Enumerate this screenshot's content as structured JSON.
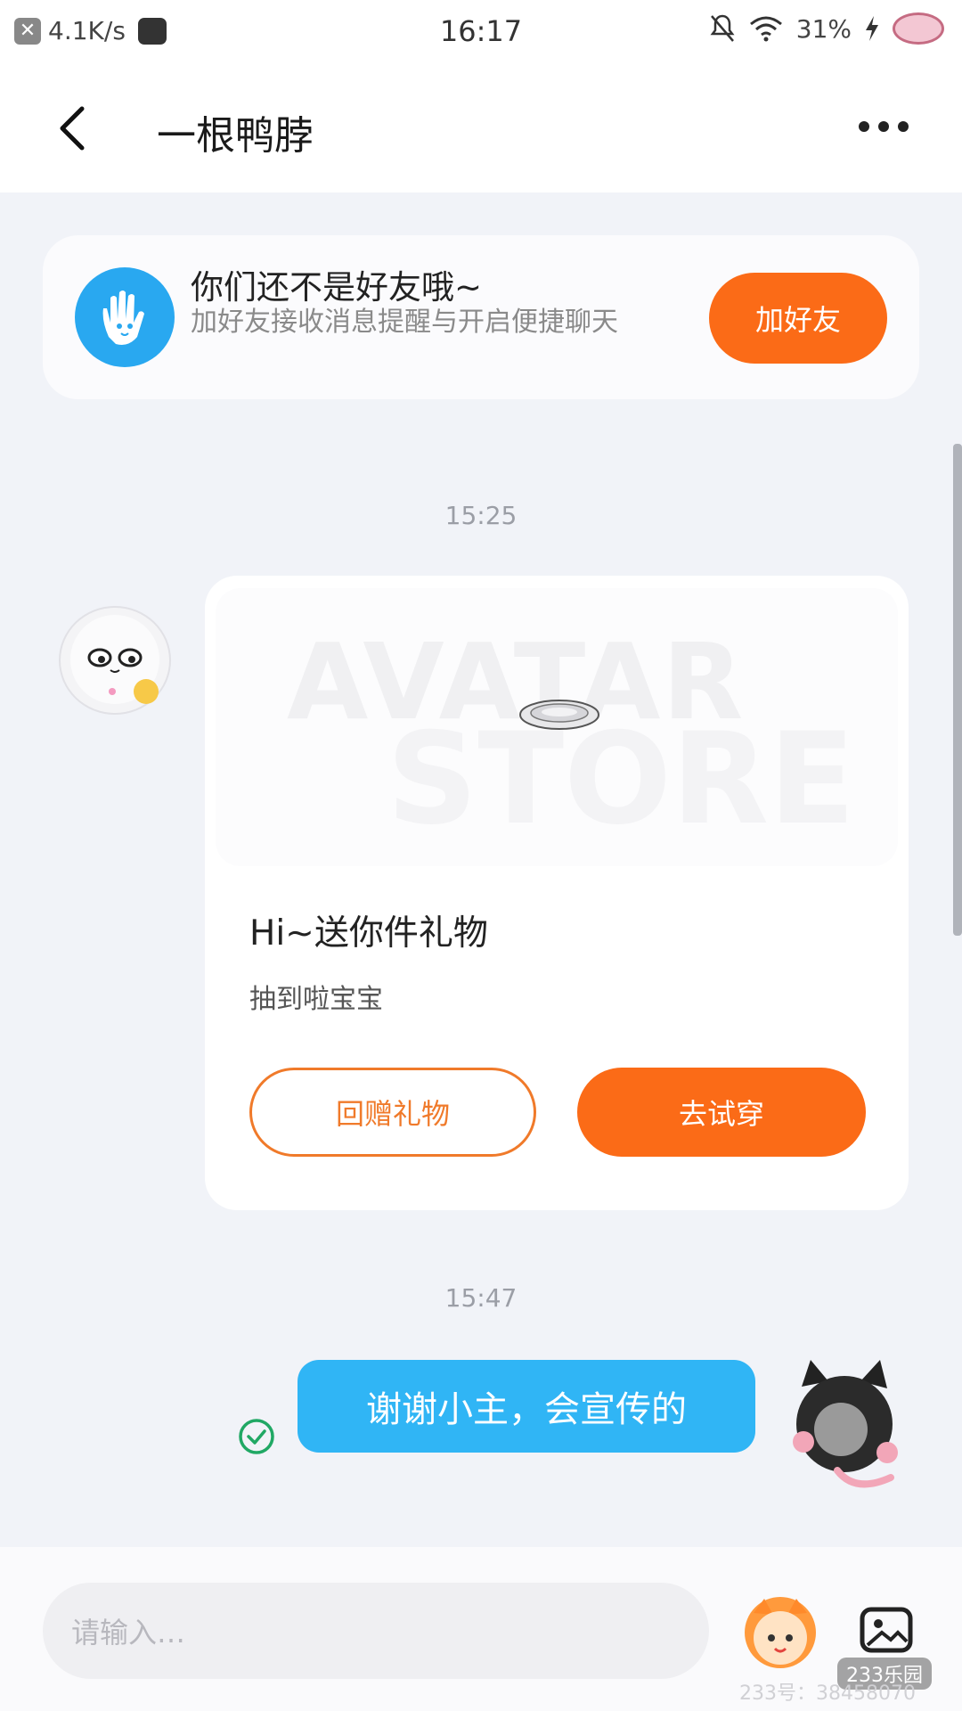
{
  "status_bar": {
    "net_speed": "4.1K/s",
    "time": "16:17",
    "battery": "31%"
  },
  "header": {
    "title": "一根鸭脖"
  },
  "friend_card": {
    "title": "你们还不是好友哦~",
    "subtitle": "加好友接收消息提醒与开启便捷聊天",
    "add_button": "加好友"
  },
  "messages": {
    "timestamp_1": "15:25",
    "gift": {
      "watermark_line1": "AVATAR",
      "watermark_line2": "STORE",
      "title": "Hi~送你件礼物",
      "subtitle": "抽到啦宝宝",
      "return_button": "回赠礼物",
      "try_button": "去试穿"
    },
    "timestamp_2": "15:47",
    "my_message": "谢谢小主，会宣传的"
  },
  "input": {
    "placeholder": "请输入…"
  },
  "watermark": {
    "brand": "233乐园",
    "account": "233号：38458070"
  },
  "colors": {
    "accent_orange": "#fb6b17",
    "accent_blue": "#30b5f5",
    "background": "#f1f3f8"
  }
}
